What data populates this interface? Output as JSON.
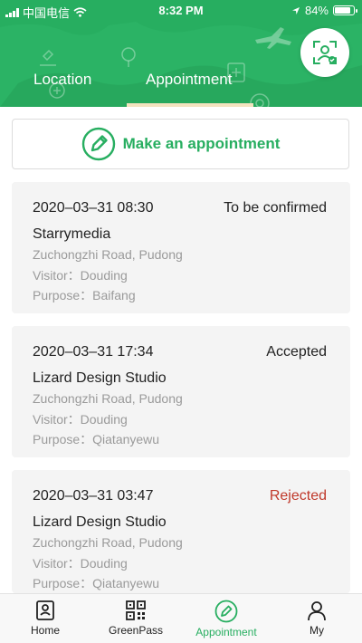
{
  "status_bar": {
    "carrier": "中国电信",
    "time": "8:32 PM",
    "battery": "84%",
    "battery_level": 0.84
  },
  "header": {
    "tabs": [
      {
        "label": "Location",
        "active": false
      },
      {
        "label": "Appointment",
        "active": true
      }
    ],
    "scan_icon": "scan-face-icon"
  },
  "make_appointment": {
    "label": "Make an appointment",
    "icon": "pen-circle-icon"
  },
  "appointments": [
    {
      "datetime": "2020–03–31 08:30",
      "status": "To be confirmed",
      "company": "Starrymedia",
      "address": "Zuchongzhi Road, Pudong",
      "visitor": "Visitor：Douding",
      "purpose": "Purpose：Baifang"
    },
    {
      "datetime": "2020–03–31 17:34",
      "status": "Accepted",
      "company": "Lizard Design Studio",
      "address": "Zuchongzhi Road, Pudong",
      "visitor": "Visitor：Douding",
      "purpose": "Purpose：Qiatanyewu"
    },
    {
      "datetime": "2020–03–31 03:47",
      "status": "Rejected",
      "company": "Lizard Design Studio",
      "address": "Zuchongzhi Road, Pudong",
      "visitor": "Visitor：Douding",
      "purpose": "Purpose：Qiatanyewu"
    }
  ],
  "tabbar": [
    {
      "label": "Home",
      "icon": "home-card-icon",
      "active": false
    },
    {
      "label": "GreenPass",
      "icon": "qr-code-icon",
      "active": false
    },
    {
      "label": "Appointment",
      "icon": "appointment-pen-icon",
      "active": true
    },
    {
      "label": "My",
      "icon": "person-icon",
      "active": false
    }
  ],
  "colors": {
    "brand": "#27ae60",
    "rejected": "#c0392b",
    "tab_indicator": "#f3e3bf"
  }
}
